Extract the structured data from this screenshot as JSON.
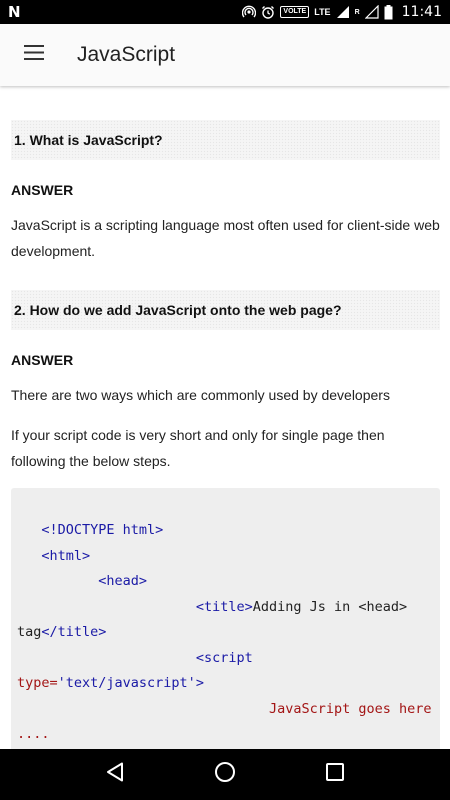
{
  "status_bar": {
    "time": "11:41",
    "volte": "VOLTE",
    "lte": "LTE",
    "roaming": "R"
  },
  "toolbar": {
    "title": "JavaScript"
  },
  "qa": [
    {
      "question": "1. What is JavaScript?",
      "answer_label": "ANSWER",
      "paragraphs": [
        "JavaScript is a scripting language most often used for client-side web development."
      ]
    },
    {
      "question": "2. How do we add JavaScript onto the web page?",
      "answer_label": "ANSWER",
      "paragraphs": [
        "There are two ways which are commonly used by developers",
        "If your script code is very short and only for single page then following the below steps."
      ]
    }
  ],
  "code": {
    "line1": "<!DOCTYPE html>",
    "line2": "<html>",
    "line3": "<head>",
    "line4_open": "<title>",
    "line4_text": "Adding Js in <head>",
    "line5_text": "tag",
    "line5_close": "</title>",
    "line6": "<script",
    "line7_attr": "type=",
    "line7_value": "'text/javascript'",
    "line7_end": ">",
    "line8": "JavaScript goes here",
    "line9": "...."
  },
  "colors": {
    "tag": "#1a1aa6",
    "string": "#0a7a36",
    "comment_red": "#a31515",
    "code_bg": "#eeeeee"
  },
  "icons": {
    "menu": "hamburger-menu-icon",
    "back": "back-triangle-icon",
    "home": "home-circle-icon",
    "recents": "recents-square-icon"
  }
}
